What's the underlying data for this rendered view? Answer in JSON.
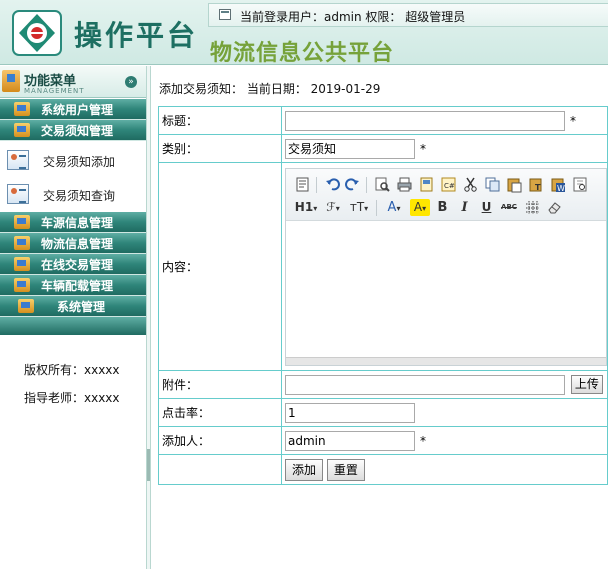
{
  "header": {
    "brand": "操作平台",
    "user_info": "当前登录用户：admin 权限： 超级管理员",
    "site_title": "物流信息公共平台"
  },
  "sidebar": {
    "title": "功能菜单",
    "subtitle": "MANAGEMENT",
    "collapse_glyph": "»",
    "groups": [
      {
        "label": "系统用户管理"
      },
      {
        "label": "交易须知管理"
      },
      {
        "label": "车源信息管理"
      },
      {
        "label": "物流信息管理"
      },
      {
        "label": "在线交易管理"
      },
      {
        "label": "车辆配载管理"
      },
      {
        "label": "系统管理"
      }
    ],
    "sub_items": [
      {
        "label": "交易须知添加"
      },
      {
        "label": "交易须知查询"
      }
    ],
    "credits": {
      "owner": "版权所有：xxxxx",
      "teacher": "指导老师：xxxxx"
    }
  },
  "main": {
    "notice": "添加交易须知： 当前日期： 2019-01-29",
    "form": {
      "title_label": "标题：",
      "title_value": "",
      "category_label": "类别：",
      "category_value": "交易须知",
      "content_label": "内容：",
      "attachment_label": "附件：",
      "attachment_value": "",
      "upload_button": "上传",
      "clicks_label": "点击率：",
      "clicks_value": "1",
      "adder_label": "添加人：",
      "adder_value": "admin",
      "required_mark": "*",
      "add_button": "添加",
      "reset_button": "重置"
    },
    "editor_toolbar": {
      "heading": "H1",
      "font_family": "ℱ",
      "font_size": "тT",
      "font_color": "A",
      "highlight": "A",
      "bold": "B",
      "italic": "I",
      "underline": "U",
      "strikethrough": "ABC"
    }
  },
  "colors": {
    "menu_bar": "#2f857a",
    "table_border": "#66cccc",
    "site_title": "#76a23a",
    "brand": "#1d6f62"
  }
}
